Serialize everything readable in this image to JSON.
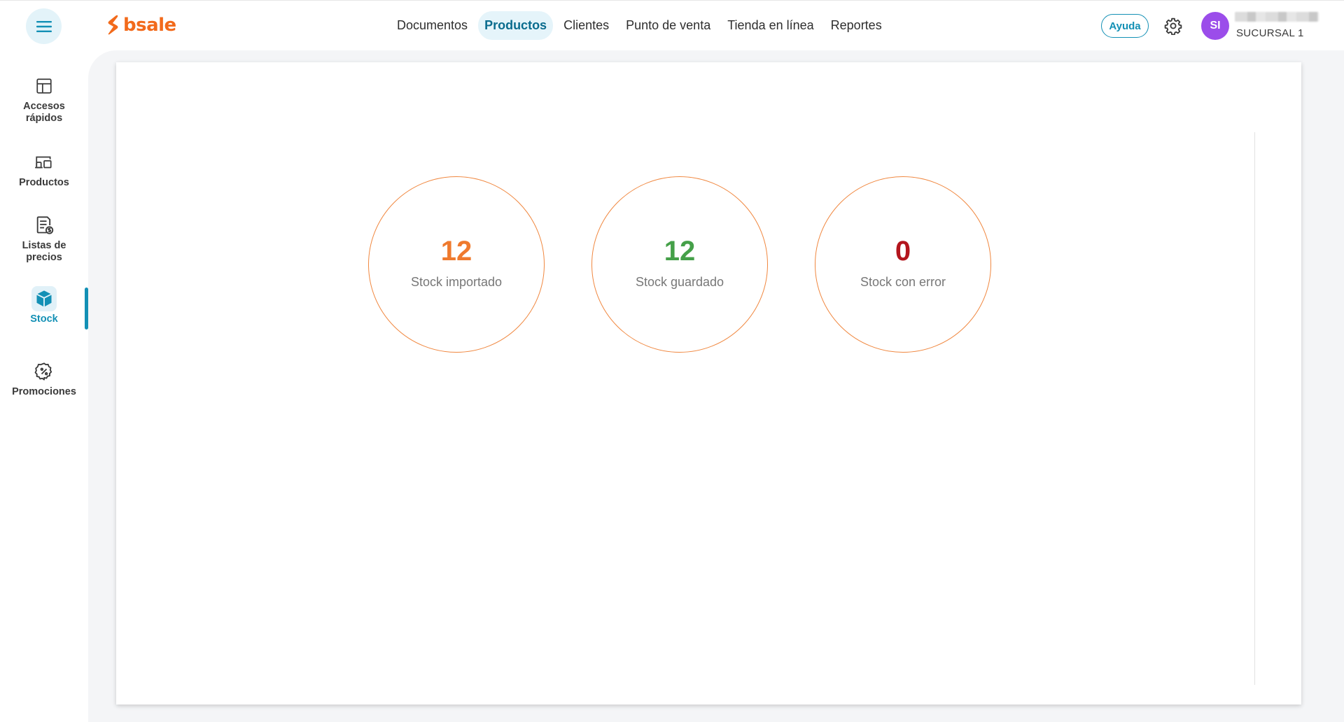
{
  "header": {
    "logo_text": "bsale",
    "nav": [
      {
        "label": "Documentos",
        "active": false
      },
      {
        "label": "Productos",
        "active": true
      },
      {
        "label": "Clientes",
        "active": false
      },
      {
        "label": "Punto de venta",
        "active": false
      },
      {
        "label": "Tienda en línea",
        "active": false
      },
      {
        "label": "Reportes",
        "active": false
      }
    ],
    "help_label": "Ayuda",
    "user_initials": "SI",
    "branch": "SUCURSAL 1"
  },
  "sidebar": {
    "items": [
      {
        "label_line1": "Accesos",
        "label_line2": "rápidos",
        "icon": "layout-icon"
      },
      {
        "label_line1": "Productos",
        "label_line2": "",
        "icon": "devices-icon"
      },
      {
        "label_line1": "Listas de",
        "label_line2": "precios",
        "icon": "price-list-icon"
      },
      {
        "label_line1": "Stock",
        "label_line2": "",
        "icon": "box-icon",
        "active": true
      },
      {
        "label_line1": "Promociones",
        "label_line2": "",
        "icon": "discount-badge-icon"
      }
    ]
  },
  "stats": [
    {
      "value": "12",
      "label": "Stock importado",
      "color": "#ef7a2e"
    },
    {
      "value": "12",
      "label": "Stock guardado",
      "color": "#45a049"
    },
    {
      "value": "0",
      "label": "Stock con error",
      "color": "#b3151d"
    }
  ],
  "colors": {
    "brand": "#f26a1b",
    "accent": "#1390b5",
    "avatar": "#9b4dea",
    "circle_border": "#f0873f"
  }
}
